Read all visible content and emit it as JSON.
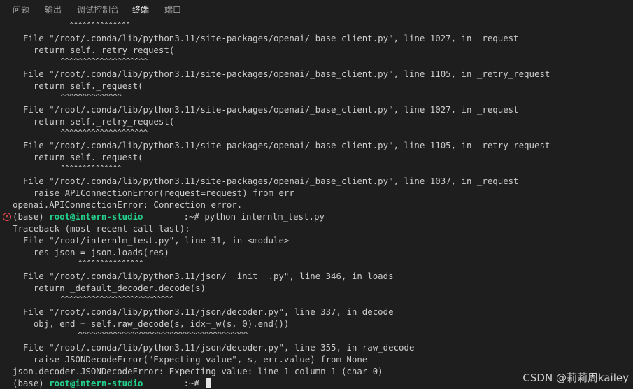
{
  "panel": {
    "tabs": [
      {
        "label": "问题"
      },
      {
        "label": "输出"
      },
      {
        "label": "调试控制台"
      },
      {
        "label": "终端"
      },
      {
        "label": "端口"
      }
    ],
    "active_tab": "终端"
  },
  "terminal": {
    "lines": [
      "             ^^^^^^^^^^^^^^",
      "  File \"/root/.conda/lib/python3.11/site-packages/openai/_base_client.py\", line 1027, in _request",
      "    return self._retry_request(",
      "           ^^^^^^^^^^^^^^^^^^^^",
      "  File \"/root/.conda/lib/python3.11/site-packages/openai/_base_client.py\", line 1105, in _retry_request",
      "    return self._request(",
      "           ^^^^^^^^^^^^^^",
      "  File \"/root/.conda/lib/python3.11/site-packages/openai/_base_client.py\", line 1027, in _request",
      "    return self._retry_request(",
      "           ^^^^^^^^^^^^^^^^^^^^",
      "  File \"/root/.conda/lib/python3.11/site-packages/openai/_base_client.py\", line 1105, in _retry_request",
      "    return self._request(",
      "           ^^^^^^^^^^^^^^",
      "  File \"/root/.conda/lib/python3.11/site-packages/openai/_base_client.py\", line 1037, in _request",
      "    raise APIConnectionError(request=request) from err",
      "openai.APIConnectionError: Connection error."
    ],
    "prompt1": {
      "prefix": "(base) ",
      "userhost": "root@intern-studio",
      "suffix": ":~# python internlm_test.py"
    },
    "lines2": [
      "Traceback (most recent call last):",
      "  File \"/root/internlm_test.py\", line 31, in <module>",
      "    res_json = json.loads(res)",
      "               ^^^^^^^^^^^^^^^",
      "  File \"/root/.conda/lib/python3.11/json/__init__.py\", line 346, in loads",
      "    return _default_decoder.decode(s)",
      "           ^^^^^^^^^^^^^^^^^^^^^^^^^^",
      "  File \"/root/.conda/lib/python3.11/json/decoder.py\", line 337, in decode",
      "    obj, end = self.raw_decode(s, idx=_w(s, 0).end())",
      "               ^^^^^^^^^^^^^^^^^^^^^^^^^^^^^^^^^^^^^^^",
      "  File \"/root/.conda/lib/python3.11/json/decoder.py\", line 355, in raw_decode",
      "    raise JSONDecodeError(\"Expecting value\", s, err.value) from None",
      "json.decoder.JSONDecodeError: Expecting value: line 1 column 1 (char 0)"
    ],
    "prompt2": {
      "prefix": "(base) ",
      "userhost": "root@intern-studio",
      "suffix": ":~# "
    }
  },
  "watermark": "CSDN @莉莉周kailey",
  "colors": {
    "background": "#1e1e1e",
    "text": "#cccccc",
    "prompt_user": "#23d18b",
    "error_icon": "#f14c4c"
  }
}
